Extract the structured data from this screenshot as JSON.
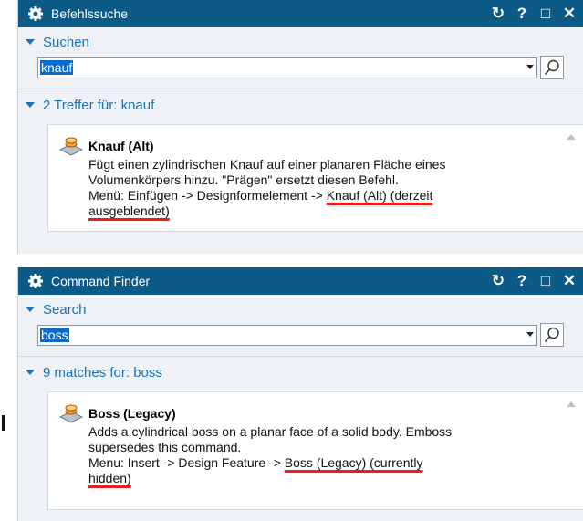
{
  "colors": {
    "titlebar": "#0c5a86",
    "section": "#1a73b8",
    "underline": "#e8201b",
    "selection": "#0a6cc8"
  },
  "icons": [
    "gear-icon",
    "refresh-icon",
    "help-icon",
    "maximize-icon",
    "close-icon",
    "dropdown-arrow-icon",
    "magnifier-icon",
    "boss-command-icon"
  ],
  "german": {
    "title": "Befehlssuche",
    "controls": {
      "refresh": "↻",
      "help": "?",
      "maximize": "□",
      "close": "✕"
    },
    "search_section": "Suchen",
    "search_value": "knauf",
    "results_section": "2 Treffer für: knauf",
    "result": {
      "name": "Knauf (Alt)",
      "desc_line1": "Fügt einen zylindrischen Knauf auf einer planaren Fläche eines",
      "desc_line2": "Volumenkörpers hinzu. \"Prägen\" ersetzt diesen Befehl.",
      "menu_prefix": "Menü: Einfügen -> Designformelement -> ",
      "menu_hl1": "Knauf (Alt) (derzeit",
      "menu_hl2": "ausgeblendet)"
    }
  },
  "english": {
    "title": "Command Finder",
    "controls": {
      "refresh": "↻",
      "help": "?",
      "maximize": "□",
      "close": "✕"
    },
    "search_section": "Search",
    "search_value": "boss",
    "results_section": "9 matches for: boss",
    "result": {
      "name": "Boss (Legacy)",
      "desc_line1": "Adds a cylindrical boss on a planar face of a solid body. Emboss",
      "desc_line2": "supersedes this command.",
      "menu_prefix": "Menu: Insert -> Design Feature -> ",
      "menu_hl1": "Boss (Legacy) (currently",
      "menu_hl2": "hidden)"
    }
  }
}
